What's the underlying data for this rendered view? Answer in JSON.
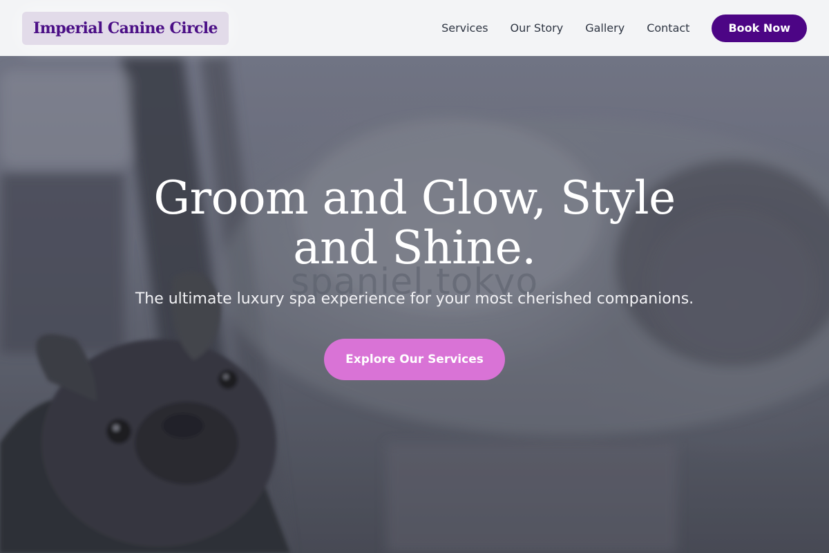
{
  "header": {
    "logo_text": "Imperial Canine Circle",
    "nav": [
      {
        "label": "Services"
      },
      {
        "label": "Our Story"
      },
      {
        "label": "Gallery"
      },
      {
        "label": "Contact"
      }
    ],
    "book_label": "Book Now"
  },
  "hero": {
    "title_line1": "Groom and Glow, Style",
    "title_line2": "and Shine.",
    "watermark": "spaniel.tokyo",
    "subtitle": "The ultimate luxury spa experience for your most cherished companions.",
    "cta_label": "Explore Our Services"
  },
  "colors": {
    "brand_purple": "#4c0585",
    "cta_pink": "#d973d6",
    "header_bg": "#f3f4f6"
  }
}
